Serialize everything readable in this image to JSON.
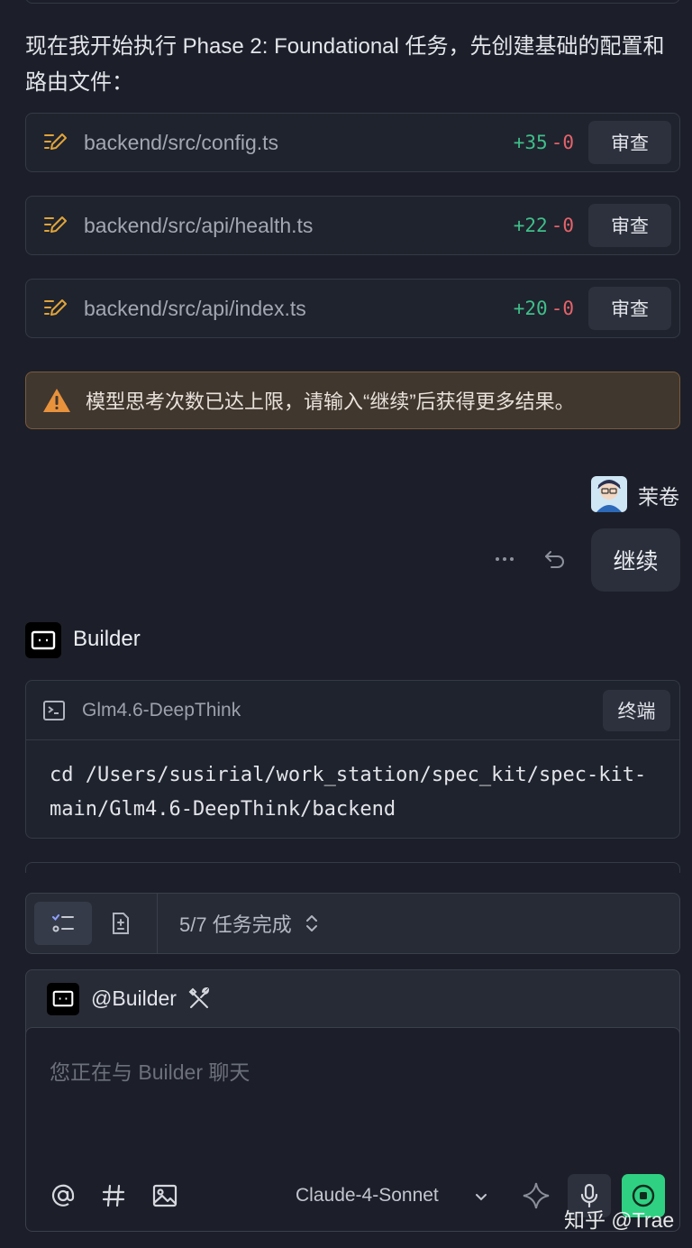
{
  "message": {
    "intro_text": "现在我开始执行 Phase 2: Foundational 任务，先创建基础的配置和路由文件："
  },
  "files": [
    {
      "path": "backend/src/config.ts",
      "added": "+35",
      "removed": "-0",
      "action": "审查"
    },
    {
      "path": "backend/src/api/health.ts",
      "added": "+22",
      "removed": "-0",
      "action": "审查"
    },
    {
      "path": "backend/src/api/index.ts",
      "added": "+20",
      "removed": "-0",
      "action": "审查"
    }
  ],
  "warning": {
    "text": "模型思考次数已达上限，请输入“继续”后获得更多结果。",
    "color": "#e8923c"
  },
  "user": {
    "name": "茉卷",
    "message": "继续"
  },
  "builder": {
    "name": "Builder"
  },
  "terminal": {
    "title": "Glm4.6-DeepThink",
    "button": "终端",
    "command": "cd /Users/susirial/work_station/spec_kit/spec-kit-main/Glm4.6-DeepThink/backend"
  },
  "tasks": {
    "status": "5/7 任务完成"
  },
  "composer": {
    "mention": "@Builder",
    "placeholder": "您正在与 Builder 聊天",
    "model": "Claude-4-Sonnet",
    "send_color": "#2fd082"
  },
  "watermark": "知乎 @Trae"
}
